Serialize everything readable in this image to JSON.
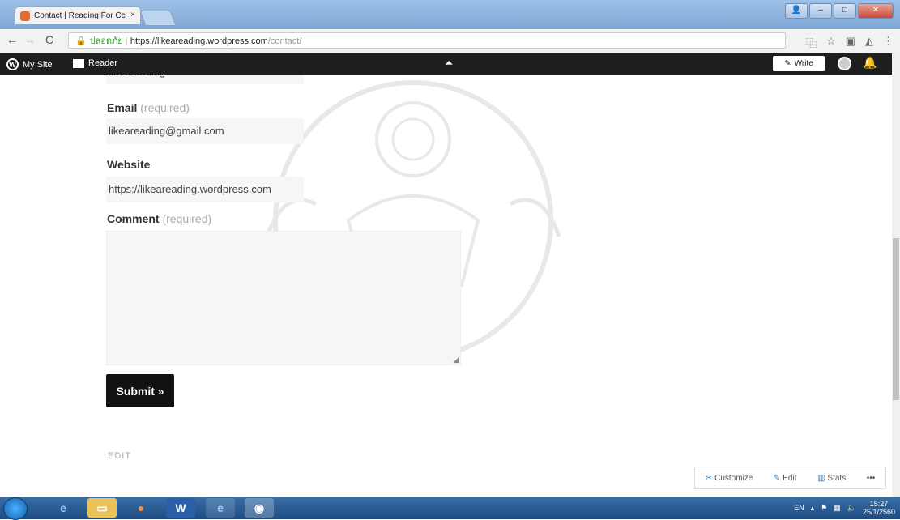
{
  "browser": {
    "tab_title": "Contact | Reading For Cc",
    "tab_close": "×",
    "secure_label": "ปลอดภัย",
    "url_host": "https://likeareading.wordpress.com",
    "url_path": "/contact/"
  },
  "wp_bar": {
    "my_site": "My Site",
    "reader": "Reader",
    "write": "Write"
  },
  "form": {
    "name_value": "likeareading",
    "email_label": "Email",
    "email_required": "(required)",
    "email_value": "likeareading@gmail.com",
    "website_label": "Website",
    "website_value": "https://likeareading.wordpress.com",
    "comment_label": "Comment",
    "comment_required": "(required)",
    "submit_label": "Submit »"
  },
  "page": {
    "edit_link": "EDIT"
  },
  "floating_bar": {
    "customize": "Customize",
    "edit": "Edit",
    "stats": "Stats",
    "more": "•••"
  },
  "taskbar": {
    "lang": "EN",
    "time": "15:27",
    "date": "25/1/2560"
  },
  "colors": {
    "wp_bar": "#1e1e1e",
    "submit_bg": "#111111",
    "taskbar": "#1d4c82"
  }
}
